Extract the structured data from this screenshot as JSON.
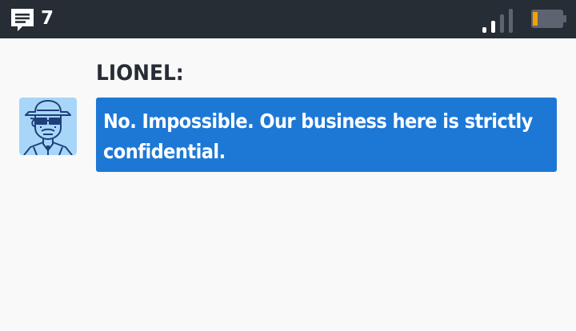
{
  "status_bar": {
    "message_icon": "chat-bubble-icon",
    "message_count": "7",
    "signal_icon": "signal-strength-icon",
    "signal_level": 0.5,
    "battery_icon": "battery-icon",
    "battery_level": 0.15
  },
  "dialogue": {
    "speaker": "LIONEL:",
    "portrait": "lionel-portrait",
    "text": "No. Impossible. Our business here is strictly confidential."
  },
  "colors": {
    "status_bar_bg": "#262d35",
    "screen_bg": "#f9f9f9",
    "bubble_bg": "#1d78d5",
    "text_light": "#ffffff",
    "text_dark": "#262d35",
    "battery_low": "#f5a000",
    "portrait_bg": "#a7d6f9",
    "portrait_line": "#1e3f7a"
  }
}
